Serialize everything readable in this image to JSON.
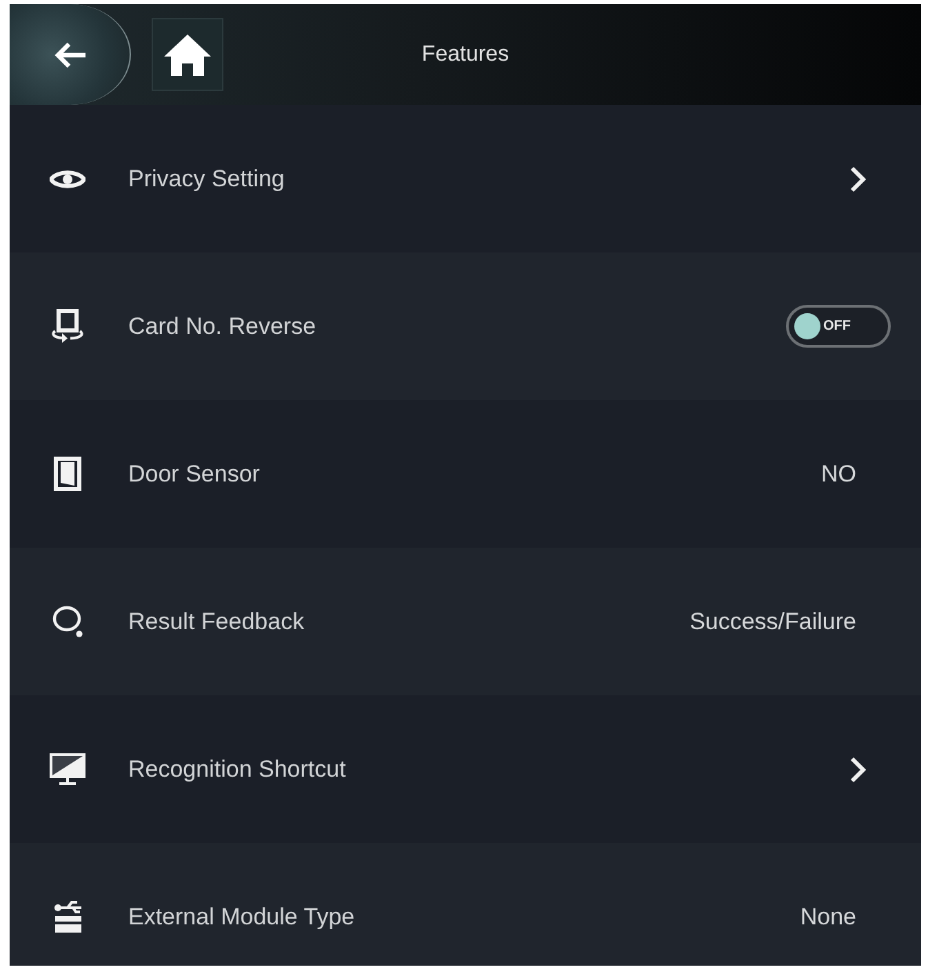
{
  "header": {
    "title": "Features"
  },
  "items": [
    {
      "label": "Privacy Setting",
      "kind": "link"
    },
    {
      "label": "Card No. Reverse",
      "kind": "toggle",
      "on": false,
      "toggle_text": "OFF"
    },
    {
      "label": "Door Sensor",
      "kind": "value",
      "value": "NO"
    },
    {
      "label": "Result Feedback",
      "kind": "value",
      "value": "Success/Failure"
    },
    {
      "label": "Recognition Shortcut",
      "kind": "link"
    },
    {
      "label": "External Module Type",
      "kind": "value",
      "value": "None"
    }
  ]
}
